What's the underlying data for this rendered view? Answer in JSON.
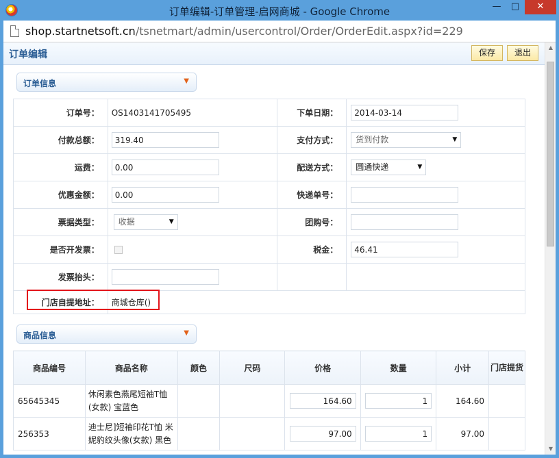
{
  "window": {
    "title": "订单编辑-订单管理-启网商城 - Google Chrome",
    "minimize_glyph": "—",
    "maximize_glyph": "□",
    "close_glyph": "✕"
  },
  "address": {
    "host": "shop.startnetsoft.cn",
    "path": "/tsnetmart/admin/usercontrol/Order/OrderEdit.aspx?id=229"
  },
  "header": {
    "title": "订单编辑",
    "save_label": "保存",
    "exit_label": "退出"
  },
  "sections": {
    "order_info": "订单信息",
    "product_info": "商品信息",
    "toggle_icon": "chevron-down-icon"
  },
  "order": {
    "order_no_label": "订单号：",
    "order_no": "OS1403141705495",
    "order_date_label": "下单日期：",
    "order_date": "2014-03-14",
    "total_label": "付款总额：",
    "total": "319.40",
    "pay_method_label": "支付方式：",
    "pay_method": "货到付款",
    "freight_label": "运费：",
    "freight": "0.00",
    "ship_method_label": "配送方式：",
    "ship_method": "圆通快递",
    "discount_label": "优惠金额：",
    "discount": "0.00",
    "tracking_label": "快递单号：",
    "tracking": "",
    "receipt_type_label": "票据类型：",
    "receipt_type": "收据",
    "group_buy_label": "团购号：",
    "group_buy": "",
    "invoice_label": "是否开发票：",
    "tax_label": "税金：",
    "tax": "46.41",
    "invoice_title_label": "发票抬头：",
    "invoice_title": "",
    "pickup_label": "门店自提地址：",
    "pickup": "商城仓库()"
  },
  "product_columns": [
    "商品编号",
    "商品名称",
    "颜色",
    "尺码",
    "价格",
    "数量",
    "小计",
    "门店提货"
  ],
  "products": [
    {
      "code": "65645345",
      "name": "休闲素色燕尾短袖T恤(女款) 宝蓝色",
      "color": "",
      "size": "",
      "price": "164.60",
      "qty": "1",
      "subtotal": "164.60",
      "pickup": ""
    },
    {
      "code": "256353",
      "name": "迪士尼]短袖印花T恤 米妮豹纹头像(女款) 黑色",
      "color": "",
      "size": "",
      "price": "97.00",
      "qty": "1",
      "subtotal": "97.00",
      "pickup": ""
    }
  ],
  "colors": {
    "titlebar": "#5aa0dc",
    "accent": "#2a5d94",
    "highlight": "#e3141b",
    "chevron": "#e2621b"
  }
}
